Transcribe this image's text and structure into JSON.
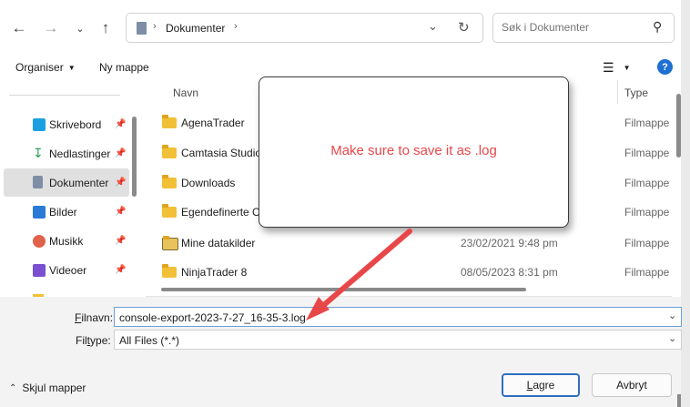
{
  "nav": {
    "back_icon": "arrow-left-icon",
    "forward_icon": "arrow-right-icon",
    "recent_icon": "chevron-down-icon",
    "up_icon": "arrow-up-icon"
  },
  "address": {
    "segment": "Dokumenter"
  },
  "search": {
    "placeholder": "Søk i Dokumenter"
  },
  "toolbar": {
    "organize_label": "Organiser",
    "new_folder_label": "Ny mappe"
  },
  "columns": {
    "name": "Navn",
    "type": "Type"
  },
  "sidebar": {
    "items": [
      {
        "label": "Skrivebord",
        "icon": "desktop-icon",
        "color": "#1ba1e2"
      },
      {
        "label": "Nedlastinger",
        "icon": "download-icon",
        "color": "#2e9b59"
      },
      {
        "label": "Dokumenter",
        "icon": "documents-icon",
        "color": "#6d7f99",
        "selected": true
      },
      {
        "label": "Bilder",
        "icon": "pictures-icon",
        "color": "#2a7bd6"
      },
      {
        "label": "Musikk",
        "icon": "music-icon",
        "color": "#e0624b"
      },
      {
        "label": "Videoer",
        "icon": "videos-icon",
        "color": "#7a4fd0"
      }
    ]
  },
  "files": [
    {
      "name": "AgenaTrader",
      "date": "",
      "type": "Filmappe"
    },
    {
      "name": "Camtasia Studio",
      "date": "",
      "type": "Filmappe"
    },
    {
      "name": "Downloads",
      "date": "",
      "type": "Filmappe"
    },
    {
      "name": "Egendefinerte O",
      "date": "",
      "type": "Filmappe"
    },
    {
      "name": "Mine datakilder",
      "date": "23/02/2021 9:48 pm",
      "type": "Filmappe"
    },
    {
      "name": "NinjaTrader 8",
      "date": "08/05/2023 8:31 pm",
      "type": "Filmappe"
    }
  ],
  "form": {
    "filename_label_u": "F",
    "filename_label_rest": "ilnavn:",
    "filename_value": "console-export-2023-7-27_16-35-3.log",
    "filetype_label_a": "Fil",
    "filetype_label_u": "t",
    "filetype_label_b": "ype:",
    "filetype_value": "All Files (*.*)"
  },
  "footer": {
    "hide_folders_label": "Skjul mapper",
    "save_label_u": "L",
    "save_label_rest": "agre",
    "cancel_label": "Avbryt"
  },
  "callout": {
    "text": "Make sure to save it as .log",
    "color": "#e8474a"
  }
}
